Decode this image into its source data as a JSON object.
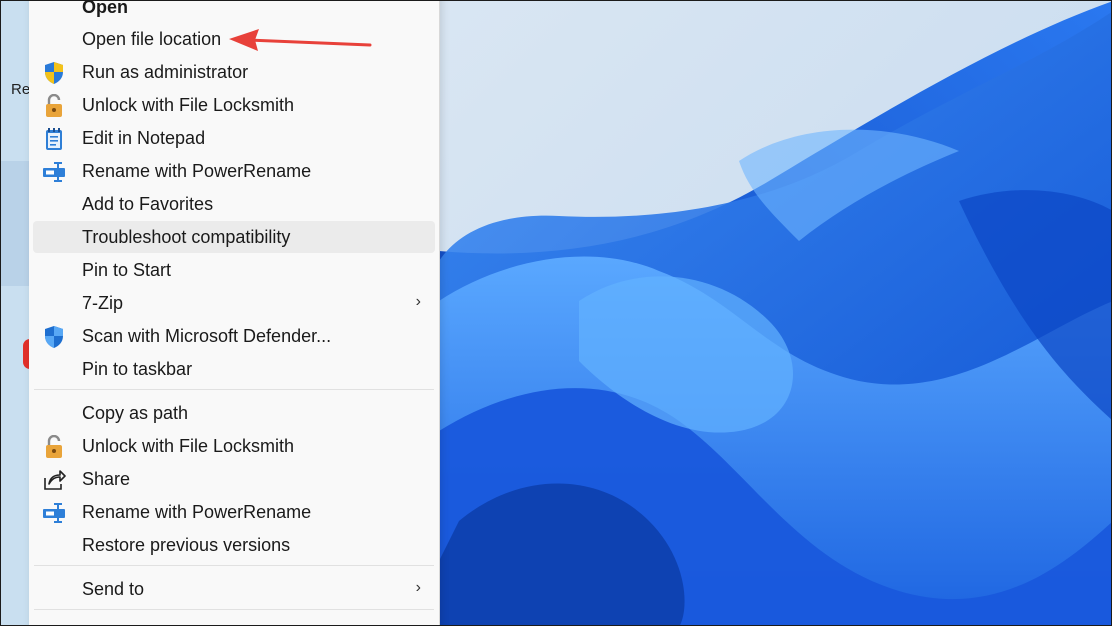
{
  "desktop": {
    "partial_label": "Re"
  },
  "menu": {
    "items": [
      {
        "label": "Open"
      },
      {
        "label": "Open file location"
      },
      {
        "label": "Run as administrator",
        "icon": "shield-uac-icon"
      },
      {
        "label": "Unlock with File Locksmith",
        "icon": "padlock-icon"
      },
      {
        "label": "Edit in Notepad",
        "icon": "notepad-icon"
      },
      {
        "label": "Rename with PowerRename",
        "icon": "powerrename-icon"
      },
      {
        "label": "Add to Favorites"
      },
      {
        "label": "Troubleshoot compatibility"
      },
      {
        "label": "Pin to Start"
      },
      {
        "label": "7-Zip",
        "submenu": "›"
      },
      {
        "label": "Scan with Microsoft Defender...",
        "icon": "defender-shield-icon"
      },
      {
        "label": "Pin to taskbar"
      },
      {
        "label": "Copy as path"
      },
      {
        "label": "Unlock with File Locksmith",
        "icon": "padlock-icon"
      },
      {
        "label": "Share",
        "icon": "share-icon"
      },
      {
        "label": "Rename with PowerRename",
        "icon": "powerrename-icon"
      },
      {
        "label": "Restore previous versions"
      },
      {
        "label": "Send to",
        "submenu": "›"
      }
    ]
  },
  "colors": {
    "menu_bg": "#f9f9f9",
    "highlight": "#ebebeb",
    "annotation_arrow": "#e8413a",
    "wallpaper_blue": "#1f6fe6"
  }
}
